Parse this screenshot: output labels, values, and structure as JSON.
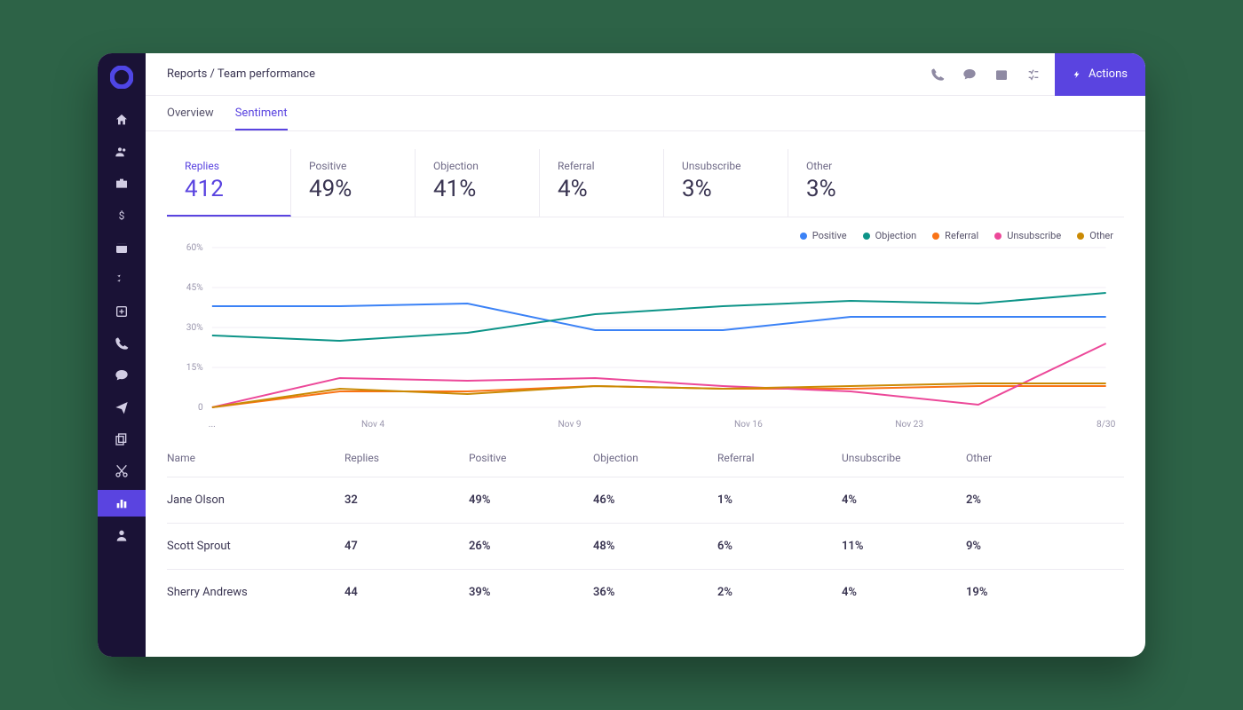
{
  "breadcrumb": "Reports / Team performance",
  "actions_label": "Actions",
  "tabs": {
    "overview": "Overview",
    "sentiment": "Sentiment"
  },
  "stats": {
    "replies_label": "Replies",
    "replies_value": "412",
    "positive_label": "Positive",
    "positive_value": "49%",
    "objection_label": "Objection",
    "objection_value": "41%",
    "referral_label": "Referral",
    "referral_value": "4%",
    "unsubscribe_label": "Unsubscribe",
    "unsubscribe_value": "3%",
    "other_label": "Other",
    "other_value": "3%"
  },
  "legend": {
    "positive": "Positive",
    "objection": "Objection",
    "referral": "Referral",
    "unsubscribe": "Unsubscribe",
    "other": "Other"
  },
  "colors": {
    "positive": "#3b82f6",
    "objection": "#0d9488",
    "referral": "#f97316",
    "unsubscribe": "#ec4899",
    "other": "#ca8a04"
  },
  "chart_data": {
    "type": "line",
    "ylabel": "%",
    "ylim": [
      0,
      60
    ],
    "yticks": [
      "0",
      "15%",
      "30%",
      "45%",
      "60%"
    ],
    "categories": [
      "...",
      "Nov 4",
      "Nov 9",
      "Nov 16",
      "Nov 23",
      "8/30"
    ],
    "series": [
      {
        "name": "Positive",
        "color": "#3b82f6",
        "values": [
          38,
          38,
          39,
          29,
          29,
          34,
          34,
          34
        ]
      },
      {
        "name": "Objection",
        "color": "#0d9488",
        "values": [
          27,
          25,
          28,
          35,
          38,
          40,
          39,
          43
        ]
      },
      {
        "name": "Referral",
        "color": "#f97316",
        "values": [
          0,
          6,
          6,
          8,
          7,
          7,
          8,
          8
        ]
      },
      {
        "name": "Unsubscribe",
        "color": "#ec4899",
        "values": [
          0,
          11,
          10,
          11,
          8,
          6,
          1,
          24
        ]
      },
      {
        "name": "Other",
        "color": "#ca8a04",
        "values": [
          0,
          7,
          5,
          8,
          7,
          8,
          9,
          9
        ]
      }
    ]
  },
  "table": {
    "headers": {
      "name": "Name",
      "replies": "Replies",
      "positive": "Positive",
      "objection": "Objection",
      "referral": "Referral",
      "unsubscribe": "Unsubscribe",
      "other": "Other"
    },
    "rows": [
      {
        "name": "Jane Olson",
        "replies": "32",
        "positive": "49%",
        "objection": "46%",
        "referral": "1%",
        "unsubscribe": "4%",
        "other": "2%"
      },
      {
        "name": "Scott Sprout",
        "replies": "47",
        "positive": "26%",
        "objection": "48%",
        "referral": "6%",
        "unsubscribe": "11%",
        "other": "9%"
      },
      {
        "name": "Sherry Andrews",
        "replies": "44",
        "positive": "39%",
        "objection": "36%",
        "referral": "2%",
        "unsubscribe": "4%",
        "other": "19%"
      }
    ]
  }
}
